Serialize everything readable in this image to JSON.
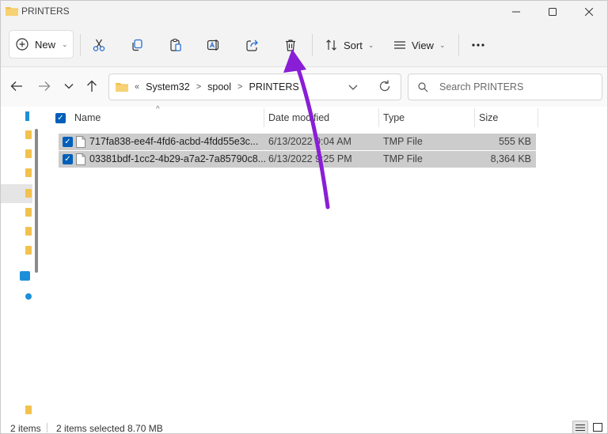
{
  "window": {
    "title": "PRINTERS"
  },
  "commandbar": {
    "new_label": "New",
    "sort_label": "Sort",
    "view_label": "View",
    "icons": [
      "cut-icon",
      "copy-icon",
      "paste-icon",
      "rename-icon",
      "share-icon",
      "delete-icon",
      "more-icon"
    ]
  },
  "address": {
    "overflow": "«",
    "segments": [
      "System32",
      "spool",
      "PRINTERS"
    ],
    "separator": ">"
  },
  "search": {
    "placeholder": "Search PRINTERS"
  },
  "filelist": {
    "columns": {
      "name": "Name",
      "date": "Date modified",
      "type": "Type",
      "size": "Size"
    },
    "rows": [
      {
        "name": "717fa838-ee4f-4fd6-acbd-4fdd55e3c...",
        "date": "6/13/2022 9:04 AM",
        "type": "TMP File",
        "size": "555 KB",
        "selected": true
      },
      {
        "name": "03381bdf-1cc2-4b29-a7a2-7a85790c8...",
        "date": "6/13/2022 9:25 PM",
        "type": "TMP File",
        "size": "8,364 KB",
        "selected": true
      }
    ]
  },
  "status": {
    "item_count": "2 items",
    "selection": "2 items selected  8.70 MB"
  },
  "colors": {
    "accent": "#005fb8",
    "selection_row": "#cccccc",
    "folder": "#f2c14e",
    "annotation_arrow": "#8a1ed6"
  }
}
